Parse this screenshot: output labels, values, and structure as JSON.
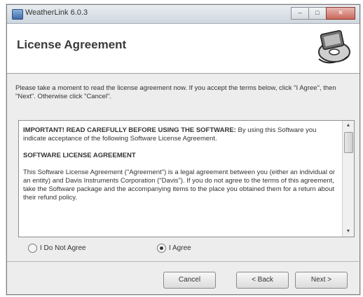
{
  "window": {
    "title": "WeatherLink 6.0.3",
    "minimize": "–",
    "maximize": "□",
    "close": "✕"
  },
  "header": {
    "title": "License Agreement",
    "graphic_icon": "installer-disk-icon"
  },
  "intro": "Please take a moment to read the license agreement now. If you accept the terms below, click \"I Agree\", then \"Next\". Otherwise click \"Cancel\".",
  "license": {
    "p1_head": "IMPORTANT! READ CAREFULLY BEFORE USING THE SOFTWARE:",
    "p1_body": " By using this Software you indicate acceptance of the following Software License Agreement.",
    "p2_head": "SOFTWARE LICENSE AGREEMENT",
    "p3": "This Software License Agreement (\"Agreement\") is a legal agreement between you (either an individual or an entity) and Davis Instruments Corporation (\"Davis\"). If you do not agree to the terms of this agreement, take the Software package and the accompanying items to the place you obtained them for a return about their refund policy."
  },
  "options": {
    "disagree": "I Do Not Agree",
    "agree": "I Agree",
    "selected": "agree"
  },
  "buttons": {
    "cancel": "Cancel",
    "back": "< Back",
    "next": "Next >"
  }
}
